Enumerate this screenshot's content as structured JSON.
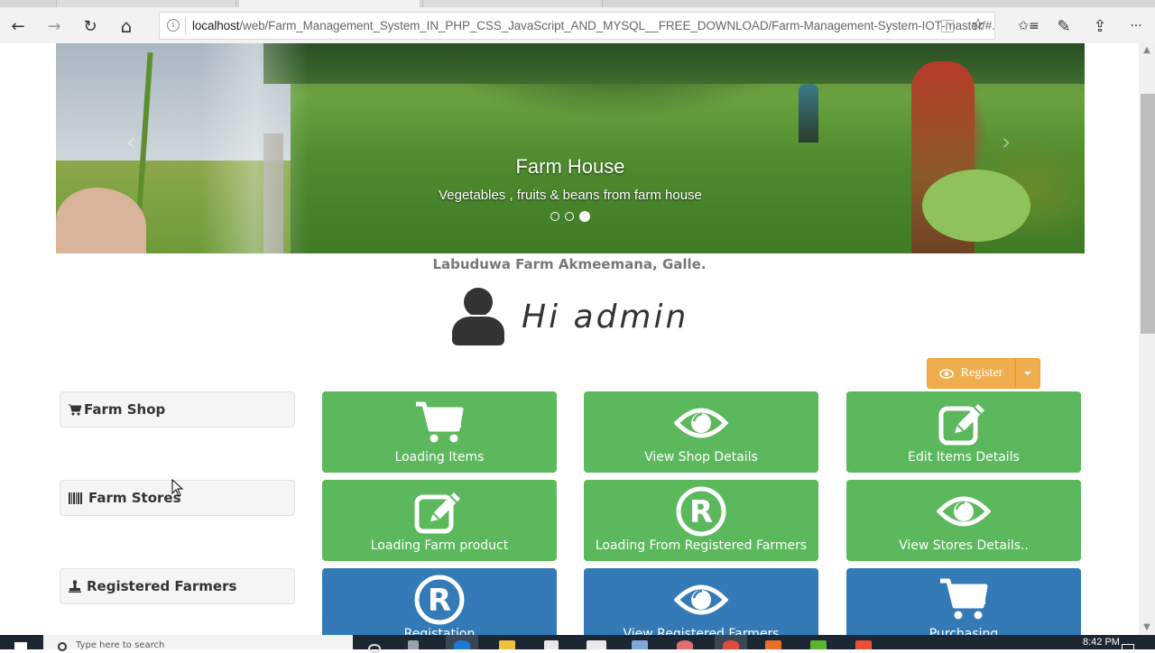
{
  "browser": {
    "url_host": "localhost",
    "url_path": "/web/Farm_Management_System_IN_PHP_CSS_JavaScript_AND_MYSQL__FREE_DOWNLOAD/Farm-Management-System-IOT-master/#.",
    "icons": {
      "back": "←",
      "forward": "→",
      "refresh": "↻",
      "home": "⌂",
      "info": "i",
      "favorite": "☆",
      "favorites_hub": "✩≡",
      "notes": "✎",
      "share": "⇪",
      "more": "···"
    }
  },
  "carousel": {
    "title": "Farm House",
    "caption": "Vegetables , fruits & beans from farm house",
    "slide_count": 3,
    "active_slide": 3,
    "prev_icon": "‹",
    "next_icon": "›"
  },
  "farm": {
    "address": "Labuduwa Farm Akmeemana, Galle."
  },
  "greeting": {
    "text": "Hi admin"
  },
  "register": {
    "label": "Register",
    "icon": "eye-icon"
  },
  "side_panels": [
    {
      "label": "Farm Shop",
      "icon": "shopping-cart-icon"
    },
    {
      "label": "Farm Stores",
      "icon": "barcode-icon"
    },
    {
      "label": "Registered Farmers",
      "icon": "stamp-icon"
    }
  ],
  "tiles": [
    {
      "label": "Loading Items",
      "icon": "shopping-cart-icon",
      "color": "#5cb85c"
    },
    {
      "label": "View Shop Details",
      "icon": "eye-icon",
      "color": "#5cb85c"
    },
    {
      "label": "Edit Items Details",
      "icon": "edit-icon",
      "color": "#5cb85c"
    },
    {
      "label": "Loading Farm product",
      "icon": "edit-icon",
      "color": "#5cb85c"
    },
    {
      "label": "Loading From Registered Farmers",
      "icon": "registered-icon",
      "color": "#5cb85c"
    },
    {
      "label": "View Stores Details..",
      "icon": "eye-icon",
      "color": "#5cb85c"
    },
    {
      "label": "Registation",
      "icon": "registered-icon",
      "color": "#337ab7"
    },
    {
      "label": "View Registered Farmers",
      "icon": "eye-icon",
      "color": "#337ab7"
    },
    {
      "label": "Purchasing",
      "icon": "shopping-cart-icon",
      "color": "#337ab7"
    }
  ],
  "colors": {
    "success": "#5cb85c",
    "primary": "#337ab7",
    "warning": "#f0ad4e"
  },
  "taskbar": {
    "search_placeholder": "Type here to search",
    "time": "8:42 PM"
  }
}
